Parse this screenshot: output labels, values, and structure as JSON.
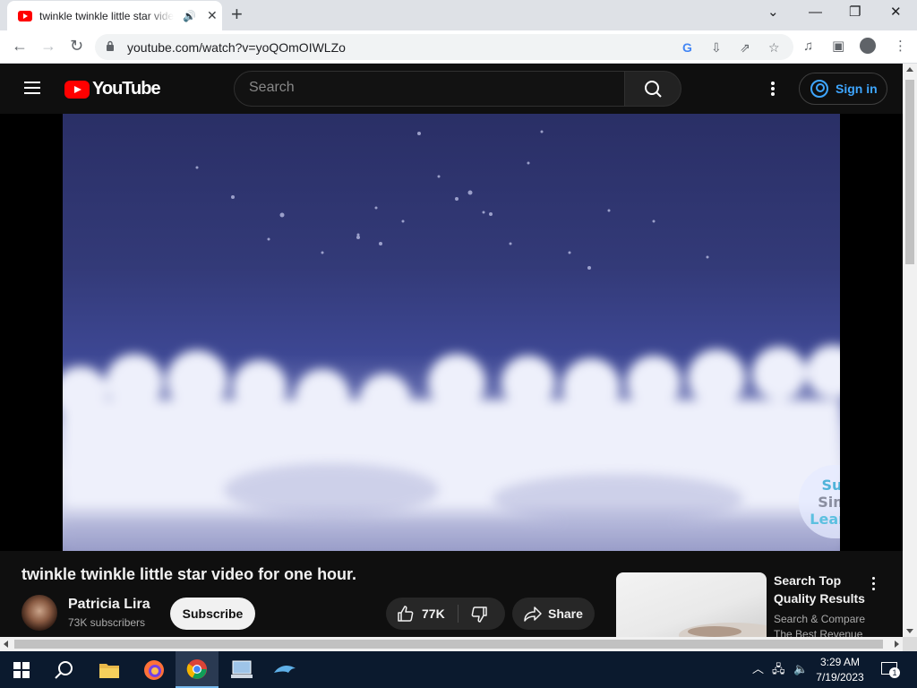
{
  "browser": {
    "tab_title": "twinkle twinkle little star video for one hour. - YouTube",
    "new_tab_symbol": "+",
    "url": "youtube.com/watch?v=yoQOmOIWLZo"
  },
  "youtube": {
    "logo_text": "YouTube",
    "search_placeholder": "Search",
    "sign_in_label": "Sign in"
  },
  "video": {
    "watermark_lines": [
      "Super",
      "Simple",
      "Learning"
    ],
    "title": "twinkle twinkle little star video for one hour.",
    "channel_name": "Patricia Lira",
    "subscribers": "73K subscribers",
    "subscribe_label": "Subscribe",
    "like_count": "77K",
    "share_label": "Share"
  },
  "ad": {
    "title": "Search Top Quality Results",
    "subtitle": "Search & Compare The Best Revenue"
  },
  "taskbar": {
    "time": "3:29 AM",
    "date": "7/19/2023",
    "notification_count": "1"
  },
  "colors": {
    "youtube_red": "#ff0000",
    "signin_blue": "#3ea6ff",
    "page_bg": "#0f0f0f"
  }
}
